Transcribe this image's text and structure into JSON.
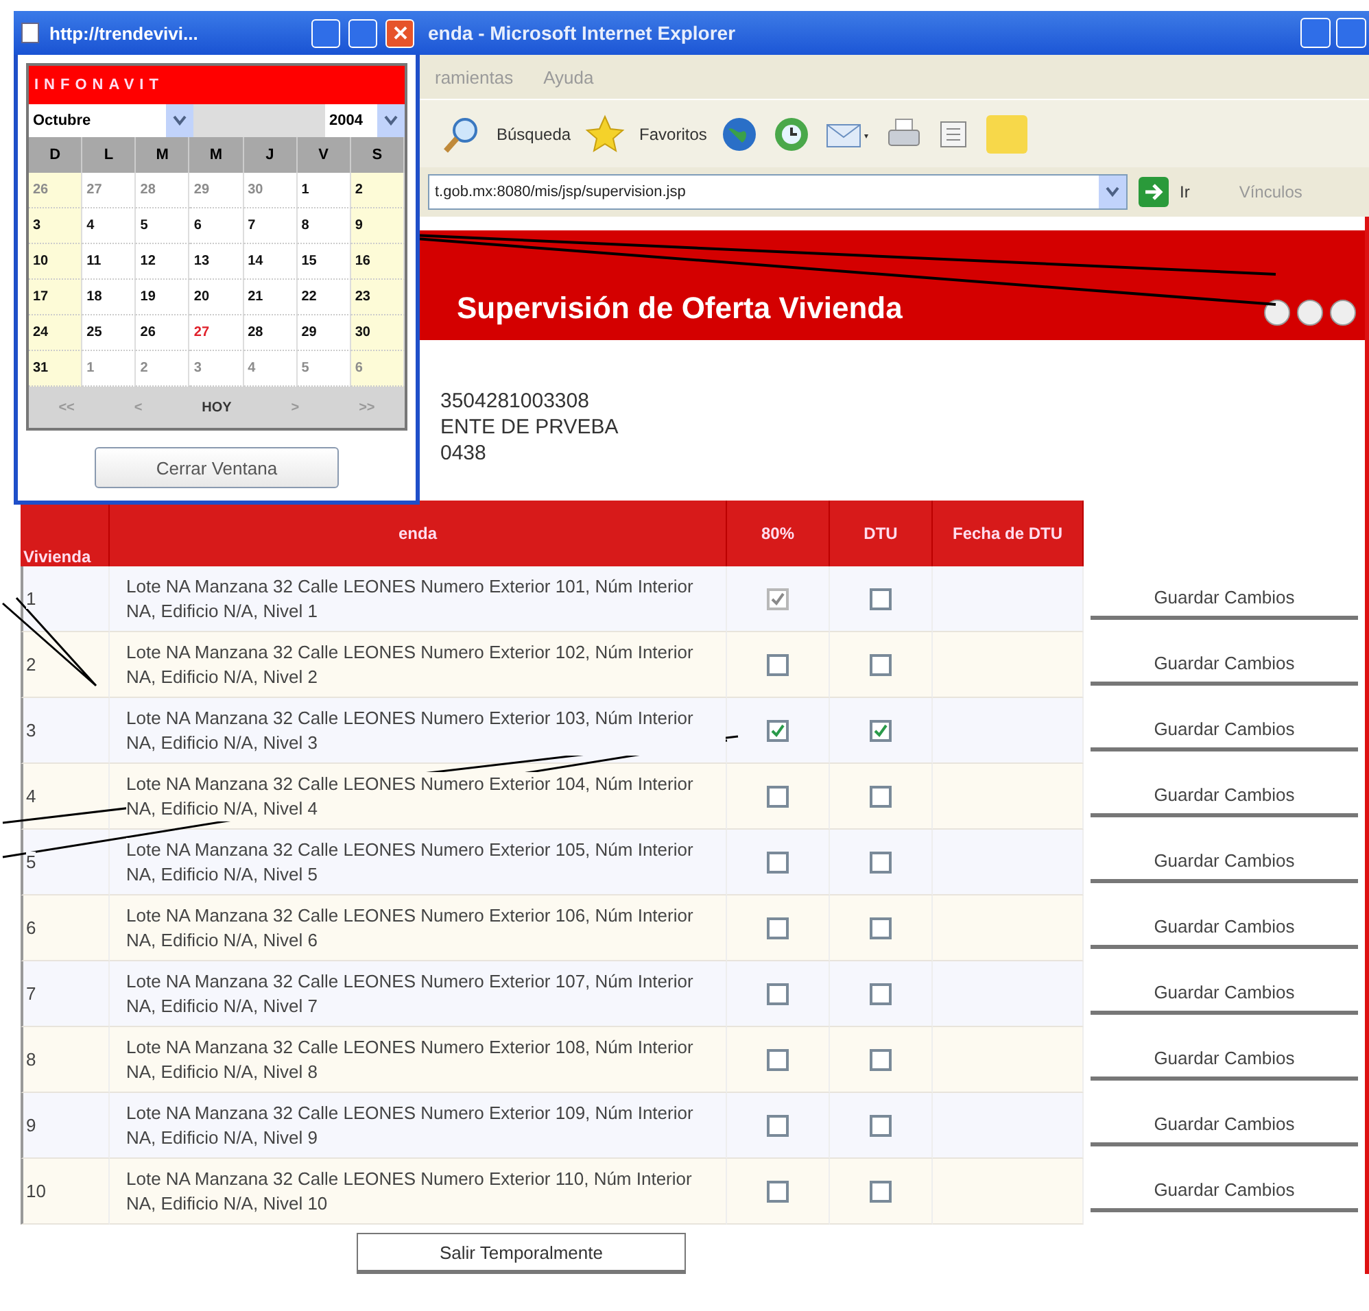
{
  "popup": {
    "title": "http://trendevivi...",
    "brand": "INFONAVIT",
    "month": "Octubre",
    "year": "2004",
    "weekdays": [
      "D",
      "L",
      "M",
      "M",
      "J",
      "V",
      "S"
    ],
    "weeks": [
      [
        {
          "day": "26",
          "other_month": true,
          "today": false
        },
        {
          "day": "27",
          "other_month": true,
          "today": false
        },
        {
          "day": "28",
          "other_month": true,
          "today": false
        },
        {
          "day": "29",
          "other_month": true,
          "today": false
        },
        {
          "day": "30",
          "other_month": true,
          "today": false
        },
        {
          "day": "1",
          "other_month": false,
          "today": false
        },
        {
          "day": "2",
          "other_month": false,
          "today": false
        }
      ],
      [
        {
          "day": "3",
          "other_month": false,
          "today": false
        },
        {
          "day": "4",
          "other_month": false,
          "today": false
        },
        {
          "day": "5",
          "other_month": false,
          "today": false
        },
        {
          "day": "6",
          "other_month": false,
          "today": false
        },
        {
          "day": "7",
          "other_month": false,
          "today": false
        },
        {
          "day": "8",
          "other_month": false,
          "today": false
        },
        {
          "day": "9",
          "other_month": false,
          "today": false
        }
      ],
      [
        {
          "day": "10",
          "other_month": false,
          "today": false
        },
        {
          "day": "11",
          "other_month": false,
          "today": false
        },
        {
          "day": "12",
          "other_month": false,
          "today": false
        },
        {
          "day": "13",
          "other_month": false,
          "today": false
        },
        {
          "day": "14",
          "other_month": false,
          "today": false
        },
        {
          "day": "15",
          "other_month": false,
          "today": false
        },
        {
          "day": "16",
          "other_month": false,
          "today": false
        }
      ],
      [
        {
          "day": "17",
          "other_month": false,
          "today": false
        },
        {
          "day": "18",
          "other_month": false,
          "today": false
        },
        {
          "day": "19",
          "other_month": false,
          "today": false
        },
        {
          "day": "20",
          "other_month": false,
          "today": false
        },
        {
          "day": "21",
          "other_month": false,
          "today": false
        },
        {
          "day": "22",
          "other_month": false,
          "today": false
        },
        {
          "day": "23",
          "other_month": false,
          "today": false
        }
      ],
      [
        {
          "day": "24",
          "other_month": false,
          "today": false
        },
        {
          "day": "25",
          "other_month": false,
          "today": false
        },
        {
          "day": "26",
          "other_month": false,
          "today": false
        },
        {
          "day": "27",
          "other_month": false,
          "today": true
        },
        {
          "day": "28",
          "other_month": false,
          "today": false
        },
        {
          "day": "29",
          "other_month": false,
          "today": false
        },
        {
          "day": "30",
          "other_month": false,
          "today": false
        }
      ],
      [
        {
          "day": "31",
          "other_month": false,
          "today": false
        },
        {
          "day": "1",
          "other_month": true,
          "today": false
        },
        {
          "day": "2",
          "other_month": true,
          "today": false
        },
        {
          "day": "3",
          "other_month": true,
          "today": false
        },
        {
          "day": "4",
          "other_month": true,
          "today": false
        },
        {
          "day": "5",
          "other_month": true,
          "today": false
        },
        {
          "day": "6",
          "other_month": true,
          "today": false
        }
      ]
    ],
    "nav": [
      "<<",
      "<",
      "HOY",
      ">",
      ">>"
    ],
    "close_button": "Cerrar Ventana"
  },
  "browser": {
    "title": "enda - Microsoft Internet Explorer",
    "menu": [
      "ramientas",
      "Ayuda"
    ],
    "toolbar": [
      "Búsqueda",
      "Favoritos"
    ],
    "address": "t.gob.mx:8080/mis/jsp/supervision.jsp",
    "go": "Ir",
    "links": "Vínculos"
  },
  "page": {
    "heading": "Supervisión de Oferta Vivienda",
    "info": [
      "3504281003308",
      "ENTE DE PRVEBA",
      "0438"
    ],
    "columns": [
      "Vivienda",
      "enda",
      "80%",
      "DTU",
      "Fecha de DTU"
    ],
    "rows": [
      {
        "number": "1",
        "address": "Lote NA Manzana 32 Calle LEONES Numero Exterior 101, Núm Interior NA, Edificio N/A, Nivel 1",
        "pct80": {
          "checked": true,
          "disabled": true
        },
        "dtu": {
          "checked": false,
          "disabled": false
        },
        "button": "Guardar Cambios"
      },
      {
        "number": "2",
        "address": "Lote NA Manzana 32 Calle LEONES Numero Exterior 102, Núm Interior NA, Edificio N/A, Nivel 2",
        "pct80": {
          "checked": false,
          "disabled": false
        },
        "dtu": {
          "checked": false,
          "disabled": false
        },
        "button": "Guardar Cambios"
      },
      {
        "number": "3",
        "address": "Lote NA Manzana 32 Calle LEONES Numero Exterior 103, Núm Interior NA, Edificio N/A, Nivel 3",
        "pct80": {
          "checked": true,
          "disabled": false
        },
        "dtu": {
          "checked": true,
          "disabled": false
        },
        "button": "Guardar Cambios"
      },
      {
        "number": "4",
        "address": "Lote NA Manzana 32 Calle LEONES Numero Exterior 104, Núm Interior NA, Edificio N/A, Nivel 4",
        "pct80": {
          "checked": false,
          "disabled": false
        },
        "dtu": {
          "checked": false,
          "disabled": false
        },
        "button": "Guardar Cambios"
      },
      {
        "number": "5",
        "address": "Lote NA Manzana 32 Calle LEONES Numero Exterior 105, Núm Interior NA, Edificio N/A, Nivel 5",
        "pct80": {
          "checked": false,
          "disabled": false
        },
        "dtu": {
          "checked": false,
          "disabled": false
        },
        "button": "Guardar Cambios"
      },
      {
        "number": "6",
        "address": "Lote NA Manzana 32 Calle LEONES Numero Exterior 106, Núm Interior NA, Edificio N/A, Nivel 6",
        "pct80": {
          "checked": false,
          "disabled": false
        },
        "dtu": {
          "checked": false,
          "disabled": false
        },
        "button": "Guardar Cambios"
      },
      {
        "number": "7",
        "address": "Lote NA Manzana 32 Calle LEONES Numero Exterior 107, Núm Interior NA, Edificio N/A, Nivel 7",
        "pct80": {
          "checked": false,
          "disabled": false
        },
        "dtu": {
          "checked": false,
          "disabled": false
        },
        "button": "Guardar Cambios"
      },
      {
        "number": "8",
        "address": "Lote NA Manzana 32 Calle LEONES Numero Exterior 108, Núm Interior NA, Edificio N/A, Nivel 8",
        "pct80": {
          "checked": false,
          "disabled": false
        },
        "dtu": {
          "checked": false,
          "disabled": false
        },
        "button": "Guardar Cambios"
      },
      {
        "number": "9",
        "address": "Lote NA Manzana 32 Calle LEONES Numero Exterior 109, Núm Interior NA, Edificio N/A, Nivel 9",
        "pct80": {
          "checked": false,
          "disabled": false
        },
        "dtu": {
          "checked": false,
          "disabled": false
        },
        "button": "Guardar Cambios"
      },
      {
        "number": "10",
        "address": "Lote NA Manzana 32 Calle LEONES Numero Exterior 110, Núm Interior NA, Edificio N/A, Nivel 10",
        "pct80": {
          "checked": false,
          "disabled": false
        },
        "dtu": {
          "checked": false,
          "disabled": false
        },
        "button": "Guardar Cambios"
      }
    ],
    "exit_button": "Salir Temporalmente"
  }
}
